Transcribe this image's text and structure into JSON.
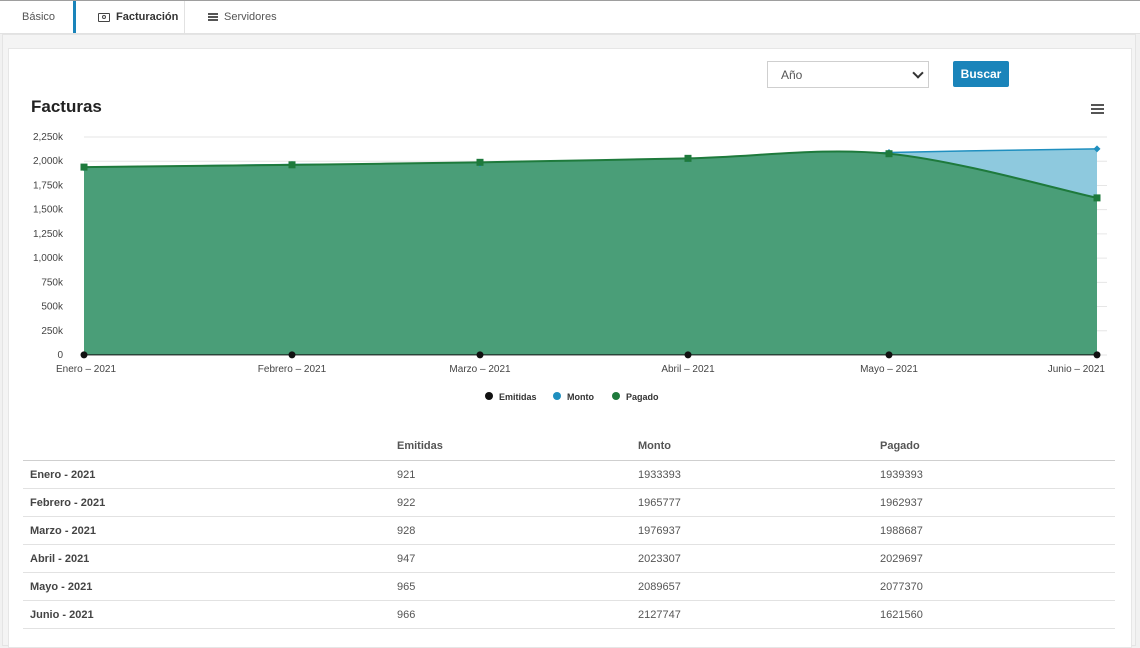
{
  "tabs": [
    {
      "label": "Básico",
      "icon": null
    },
    {
      "label": "Facturación",
      "icon": "bill-icon"
    },
    {
      "label": "Servidores",
      "icon": "list-icon"
    }
  ],
  "filter": {
    "select_value": "Año",
    "button_label": "Buscar"
  },
  "colors": {
    "accent": "#1a84ba",
    "emitidas": "#111111",
    "monto": "#1f8fbf",
    "pagado": "#1e7a3c",
    "pagado_fill": "#4a9e78",
    "monto_fill": "#8ec9de"
  },
  "chart_data": {
    "type": "area",
    "title": "Facturas",
    "categories": [
      "Enero – 2021",
      "Febrero – 2021",
      "Marzo – 2021",
      "Abril – 2021",
      "Mayo – 2021",
      "Junio – 2021"
    ],
    "yticks": [
      "0",
      "250k",
      "500k",
      "750k",
      "1,000k",
      "1,250k",
      "1,500k",
      "1,750k",
      "2,000k",
      "2,250k"
    ],
    "ylim": [
      0,
      2250000
    ],
    "grid": true,
    "legend_position": "bottom-center",
    "series": [
      {
        "name": "Emitidas",
        "values": [
          921,
          922,
          928,
          947,
          965,
          966
        ]
      },
      {
        "name": "Monto",
        "values": [
          1933393,
          1965777,
          1976937,
          2023307,
          2089657,
          2127747
        ]
      },
      {
        "name": "Pagado",
        "values": [
          1939393,
          1962937,
          1988687,
          2029697,
          2077370,
          1621560
        ]
      }
    ]
  },
  "table": {
    "headers": [
      "",
      "Emitidas",
      "Monto",
      "Pagado"
    ],
    "rows": [
      [
        "Enero - 2021",
        "921",
        "1933393",
        "1939393"
      ],
      [
        "Febrero - 2021",
        "922",
        "1965777",
        "1962937"
      ],
      [
        "Marzo - 2021",
        "928",
        "1976937",
        "1988687"
      ],
      [
        "Abril - 2021",
        "947",
        "2023307",
        "2029697"
      ],
      [
        "Mayo - 2021",
        "965",
        "2089657",
        "2077370"
      ],
      [
        "Junio - 2021",
        "966",
        "2127747",
        "1621560"
      ]
    ]
  }
}
